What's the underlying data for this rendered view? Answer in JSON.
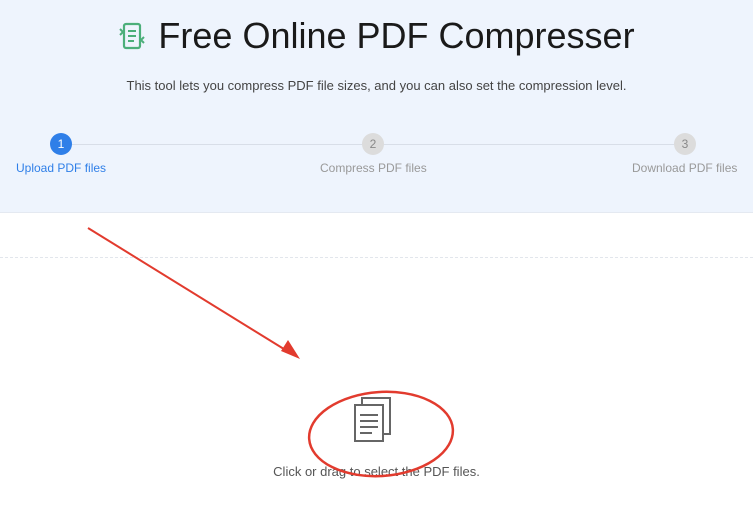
{
  "header": {
    "title": "Free Online PDF Compresser",
    "subtitle": "This tool lets you compress PDF file sizes, and you can also set the compression level.",
    "logo_icon": "compress-file-icon",
    "accent_color": "#4caf7a"
  },
  "steps": [
    {
      "number": "1",
      "label": "Upload PDF files",
      "state": "active"
    },
    {
      "number": "2",
      "label": "Compress PDF files",
      "state": "inactive"
    },
    {
      "number": "3",
      "label": "Download PDF files",
      "state": "inactive"
    }
  ],
  "upload": {
    "icon": "documents-icon",
    "prompt": "Click or drag to select the PDF files."
  },
  "colors": {
    "active_step": "#2f7fe8",
    "annotation_red": "#e23b2e"
  }
}
